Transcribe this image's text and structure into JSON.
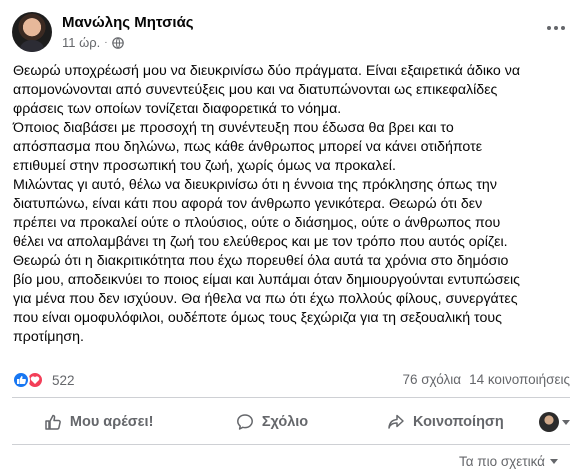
{
  "post": {
    "author": "Μανώλης Μητσιάς",
    "time": "11 ώρ.",
    "separator": "·",
    "privacy_icon": "globe-icon",
    "more_icon": "more-horizontal-icon",
    "paragraphs": [
      "Θεωρώ υποχρέωσή μου να διευκρινίσω δύο πράγματα. Είναι εξαιρετικά άδικο να",
      "απομονώνονται από συνεντεύξεις μου και να διατυπώνονται ως επικεφαλίδες",
      "φράσεις των οποίων τονίζεται διαφορετικά το νόημα.",
      "Όποιος διαβάσει με προσοχή τη συνέντευξη που έδωσα θα βρει και το",
      "απόσπασμα που δηλώνω, πως κάθε άνθρωπος μπορεί να κάνει οτιδήποτε",
      "επιθυμεί στην προσωπική του ζωή, χωρίς όμως να προκαλεί.",
      "Μιλώντας γι αυτό, θέλω να διευκρινίσω ότι η έννοια της πρόκλησης όπως την",
      "διατυπώνω, είναι κάτι που αφορά τον άνθρωπο γενικότερα. Θεωρώ ότι δεν",
      "πρέπει να προκαλεί ούτε ο πλούσιος, ούτε ο διάσημος, ούτε ο άνθρωπος που",
      "θέλει να απολαμβάνει τη ζωή του ελεύθερος και με τον τρόπο που αυτός ορίζει.",
      "Θεωρώ ότι η διακριτικότητα που έχω πορευθεί όλα αυτά τα χρόνια στο δημόσιο",
      "βίο μου, αποδεικνύει το ποιος είμαι και λυπάμαι όταν δημιουργούνται εντυπώσεις",
      "για μένα που δεν ισχύουν. Θα ήθελα να πω ότι έχω πολλούς φίλους, συνεργάτες",
      "που είναι ομοφυλόφιλοι, ουδέποτε όμως τους ξεχώριζα για τη σεξουαλική τους",
      "προτίμηση."
    ]
  },
  "stats": {
    "reactions_count": "522",
    "comments": "76 σχόλια",
    "shares": "14 κοινοποιήσεις",
    "like_color": "#1877f2",
    "love_color": "#f33e58"
  },
  "actions": {
    "like": "Μου αρέσει!",
    "comment": "Σχόλιο",
    "share": "Κοινοποίηση"
  },
  "footer": {
    "sort_label": "Τα πιο σχετικά"
  }
}
